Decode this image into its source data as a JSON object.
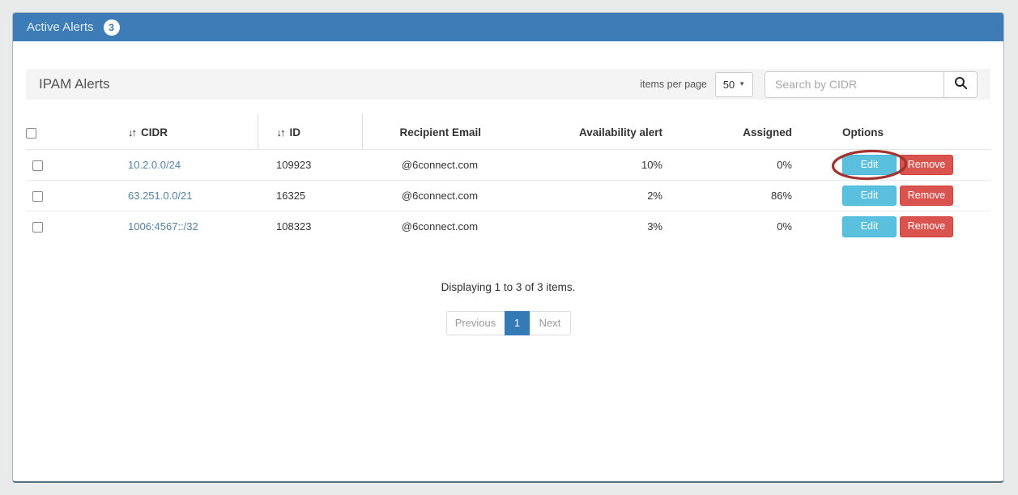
{
  "panel": {
    "title": "Active Alerts",
    "badge": "3"
  },
  "toolbar": {
    "section_title": "IPAM Alerts",
    "items_per_page_label": "items per page",
    "items_per_page_value": "50",
    "search_placeholder": "Search by CIDR"
  },
  "icons": {
    "sort": "↓↑",
    "caret": "▼"
  },
  "table": {
    "columns": {
      "cidr": "CIDR",
      "id": "ID",
      "email": "Recipient Email",
      "availability": "Availability alert",
      "assigned": "Assigned",
      "options": "Options"
    },
    "edit_label": "Edit",
    "remove_label": "Remove",
    "rows": [
      {
        "cidr": "10.2.0.0/24",
        "id": "109923",
        "email": "@6connect.com",
        "availability": "10%",
        "assigned": "0%"
      },
      {
        "cidr": "63.251.0.0/21",
        "id": "16325",
        "email": "@6connect.com",
        "availability": "2%",
        "assigned": "86%"
      },
      {
        "cidr": "1006:4567::/32",
        "id": "108323",
        "email": "@6connect.com",
        "availability": "3%",
        "assigned": "0%"
      }
    ]
  },
  "pagination": {
    "summary": "Displaying 1 to 3 of 3 items.",
    "previous": "Previous",
    "page": "1",
    "next": "Next"
  },
  "colors": {
    "header_blue": "#3e7cb8",
    "edit_button": "#5bc0de",
    "remove_button": "#d9534f",
    "active_page": "#337ab7",
    "cidr_link": "#5682a3",
    "annotation_red": "#a33331"
  }
}
